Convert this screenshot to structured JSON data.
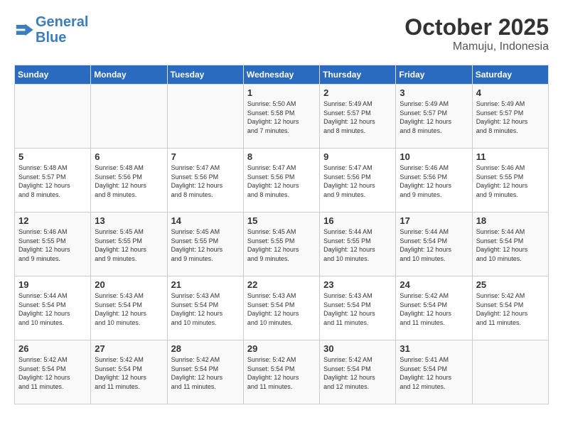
{
  "header": {
    "logo_line1": "General",
    "logo_line2": "Blue",
    "month": "October 2025",
    "location": "Mamuju, Indonesia"
  },
  "weekdays": [
    "Sunday",
    "Monday",
    "Tuesday",
    "Wednesday",
    "Thursday",
    "Friday",
    "Saturday"
  ],
  "weeks": [
    [
      {
        "day": "",
        "info": ""
      },
      {
        "day": "",
        "info": ""
      },
      {
        "day": "",
        "info": ""
      },
      {
        "day": "1",
        "info": "Sunrise: 5:50 AM\nSunset: 5:58 PM\nDaylight: 12 hours\nand 7 minutes."
      },
      {
        "day": "2",
        "info": "Sunrise: 5:49 AM\nSunset: 5:57 PM\nDaylight: 12 hours\nand 8 minutes."
      },
      {
        "day": "3",
        "info": "Sunrise: 5:49 AM\nSunset: 5:57 PM\nDaylight: 12 hours\nand 8 minutes."
      },
      {
        "day": "4",
        "info": "Sunrise: 5:49 AM\nSunset: 5:57 PM\nDaylight: 12 hours\nand 8 minutes."
      }
    ],
    [
      {
        "day": "5",
        "info": "Sunrise: 5:48 AM\nSunset: 5:57 PM\nDaylight: 12 hours\nand 8 minutes."
      },
      {
        "day": "6",
        "info": "Sunrise: 5:48 AM\nSunset: 5:56 PM\nDaylight: 12 hours\nand 8 minutes."
      },
      {
        "day": "7",
        "info": "Sunrise: 5:47 AM\nSunset: 5:56 PM\nDaylight: 12 hours\nand 8 minutes."
      },
      {
        "day": "8",
        "info": "Sunrise: 5:47 AM\nSunset: 5:56 PM\nDaylight: 12 hours\nand 8 minutes."
      },
      {
        "day": "9",
        "info": "Sunrise: 5:47 AM\nSunset: 5:56 PM\nDaylight: 12 hours\nand 9 minutes."
      },
      {
        "day": "10",
        "info": "Sunrise: 5:46 AM\nSunset: 5:56 PM\nDaylight: 12 hours\nand 9 minutes."
      },
      {
        "day": "11",
        "info": "Sunrise: 5:46 AM\nSunset: 5:55 PM\nDaylight: 12 hours\nand 9 minutes."
      }
    ],
    [
      {
        "day": "12",
        "info": "Sunrise: 5:46 AM\nSunset: 5:55 PM\nDaylight: 12 hours\nand 9 minutes."
      },
      {
        "day": "13",
        "info": "Sunrise: 5:45 AM\nSunset: 5:55 PM\nDaylight: 12 hours\nand 9 minutes."
      },
      {
        "day": "14",
        "info": "Sunrise: 5:45 AM\nSunset: 5:55 PM\nDaylight: 12 hours\nand 9 minutes."
      },
      {
        "day": "15",
        "info": "Sunrise: 5:45 AM\nSunset: 5:55 PM\nDaylight: 12 hours\nand 9 minutes."
      },
      {
        "day": "16",
        "info": "Sunrise: 5:44 AM\nSunset: 5:55 PM\nDaylight: 12 hours\nand 10 minutes."
      },
      {
        "day": "17",
        "info": "Sunrise: 5:44 AM\nSunset: 5:54 PM\nDaylight: 12 hours\nand 10 minutes."
      },
      {
        "day": "18",
        "info": "Sunrise: 5:44 AM\nSunset: 5:54 PM\nDaylight: 12 hours\nand 10 minutes."
      }
    ],
    [
      {
        "day": "19",
        "info": "Sunrise: 5:44 AM\nSunset: 5:54 PM\nDaylight: 12 hours\nand 10 minutes."
      },
      {
        "day": "20",
        "info": "Sunrise: 5:43 AM\nSunset: 5:54 PM\nDaylight: 12 hours\nand 10 minutes."
      },
      {
        "day": "21",
        "info": "Sunrise: 5:43 AM\nSunset: 5:54 PM\nDaylight: 12 hours\nand 10 minutes."
      },
      {
        "day": "22",
        "info": "Sunrise: 5:43 AM\nSunset: 5:54 PM\nDaylight: 12 hours\nand 10 minutes."
      },
      {
        "day": "23",
        "info": "Sunrise: 5:43 AM\nSunset: 5:54 PM\nDaylight: 12 hours\nand 11 minutes."
      },
      {
        "day": "24",
        "info": "Sunrise: 5:42 AM\nSunset: 5:54 PM\nDaylight: 12 hours\nand 11 minutes."
      },
      {
        "day": "25",
        "info": "Sunrise: 5:42 AM\nSunset: 5:54 PM\nDaylight: 12 hours\nand 11 minutes."
      }
    ],
    [
      {
        "day": "26",
        "info": "Sunrise: 5:42 AM\nSunset: 5:54 PM\nDaylight: 12 hours\nand 11 minutes."
      },
      {
        "day": "27",
        "info": "Sunrise: 5:42 AM\nSunset: 5:54 PM\nDaylight: 12 hours\nand 11 minutes."
      },
      {
        "day": "28",
        "info": "Sunrise: 5:42 AM\nSunset: 5:54 PM\nDaylight: 12 hours\nand 11 minutes."
      },
      {
        "day": "29",
        "info": "Sunrise: 5:42 AM\nSunset: 5:54 PM\nDaylight: 12 hours\nand 11 minutes."
      },
      {
        "day": "30",
        "info": "Sunrise: 5:42 AM\nSunset: 5:54 PM\nDaylight: 12 hours\nand 12 minutes."
      },
      {
        "day": "31",
        "info": "Sunrise: 5:41 AM\nSunset: 5:54 PM\nDaylight: 12 hours\nand 12 minutes."
      },
      {
        "day": "",
        "info": ""
      }
    ]
  ]
}
